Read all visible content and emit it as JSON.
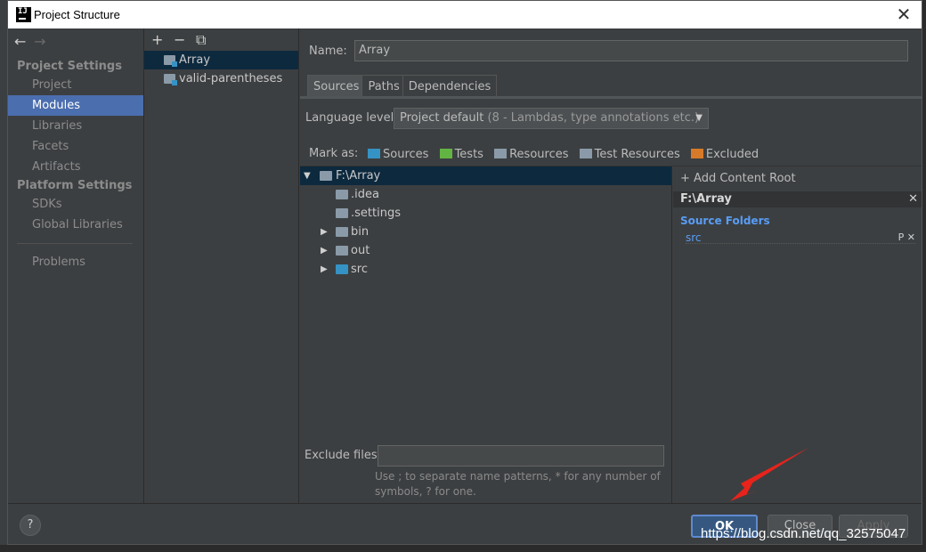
{
  "window": {
    "title": "Project Structure",
    "close_glyph": "✕"
  },
  "nav": {
    "back_glyph": "←",
    "forward_glyph": "→",
    "project_settings_header": "Project Settings",
    "project_items": [
      "Project",
      "Modules",
      "Libraries",
      "Facets",
      "Artifacts"
    ],
    "platform_settings_header": "Platform Settings",
    "platform_items": [
      "SDKs",
      "Global Libraries"
    ],
    "problems": "Problems",
    "selected": "Modules"
  },
  "modules": {
    "toolbar": {
      "add": "+",
      "remove": "−",
      "copy": "⧉"
    },
    "items": [
      "Array",
      "valid-parentheses"
    ],
    "selected": "Array"
  },
  "module": {
    "name_label": "Name:",
    "name_value": "Array",
    "tabs": [
      "Sources",
      "Paths",
      "Dependencies"
    ],
    "active_tab": "Sources",
    "language_level_label": "Language level:",
    "language_level_value": "Project default",
    "language_level_detail": "(8 - Lambdas, type annotations etc.)",
    "mark_as_label": "Mark as:",
    "mark_as": [
      {
        "label": "Sources",
        "color": "#3592c4"
      },
      {
        "label": "Tests",
        "color": "#62b543"
      },
      {
        "label": "Resources",
        "color": "#8a9aa8"
      },
      {
        "label": "Test Resources",
        "color": "#8a9aa8"
      },
      {
        "label": "Excluded",
        "color": "#d77b2a"
      }
    ]
  },
  "tree": {
    "root": "F:\\Array",
    "children": [
      {
        "label": ".idea",
        "expandable": false
      },
      {
        "label": ".settings",
        "expandable": false
      },
      {
        "label": "bin",
        "expandable": true
      },
      {
        "label": "out",
        "expandable": true
      },
      {
        "label": "src",
        "expandable": true
      }
    ]
  },
  "exclude": {
    "label": "Exclude files:",
    "value": "",
    "hint_line1": "Use ; to separate name patterns, * for any number of",
    "hint_line2": "symbols, ? for one."
  },
  "content_root": {
    "add_label": "+ Add Content Root",
    "root_path": "F:\\Array",
    "source_folders_title": "Source Folders",
    "source_folders": [
      "src"
    ],
    "remove_glyph": "✕",
    "props_glyph": "P"
  },
  "footer": {
    "help": "?",
    "ok": "OK",
    "close": "Close",
    "apply": "Apply"
  },
  "watermark": "https://blog.csdn.net/qq_32575047"
}
